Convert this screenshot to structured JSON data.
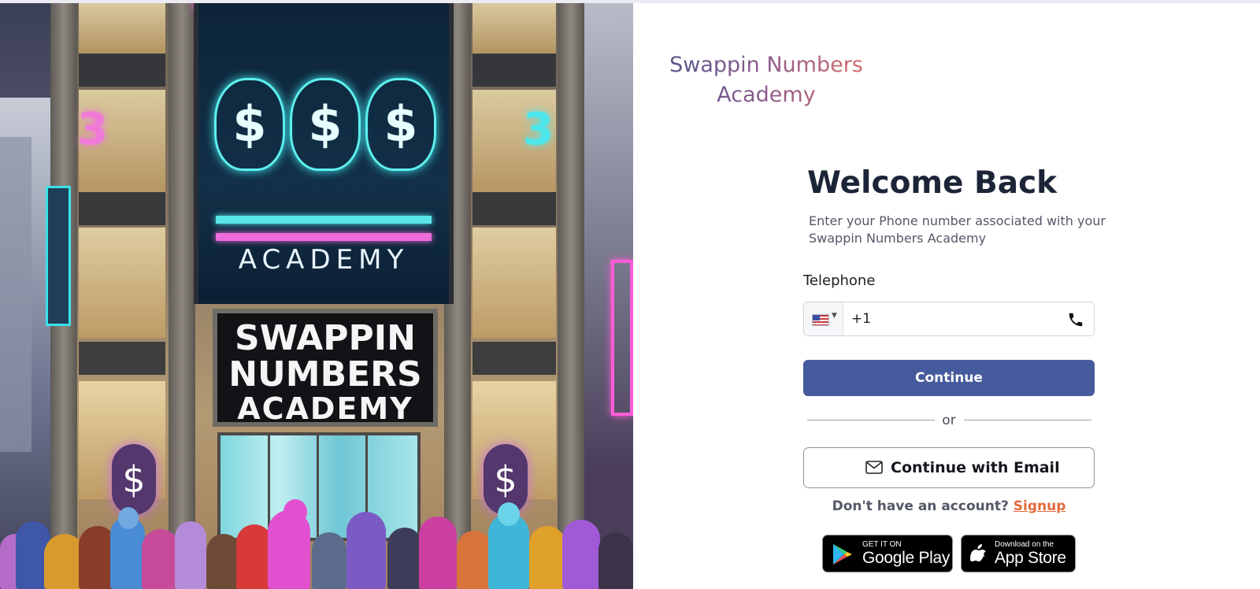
{
  "brand": {
    "line1": "Swappin Numbers",
    "line2": "Academy"
  },
  "hero": {
    "screen_sign": "ACADEMY",
    "marquee": [
      "SWAPPIN",
      "NUMBERS",
      "ACADEMY"
    ],
    "bag_symbol": "$",
    "neon_numbers": [
      "3",
      "3"
    ]
  },
  "login": {
    "title": "Welcome Back",
    "subtitle": "Enter your Phone number associated with your Swappin Numbers Academy",
    "telephone_label": "Telephone",
    "telephone_value": "+1",
    "country_flag": "us-flag-icon",
    "continue_label": "Continue",
    "or_label": "or",
    "email_button_label": "Continue with Email",
    "no_account_text": "Don't have an account?",
    "signup_label": "Signup"
  },
  "stores": {
    "google": {
      "small": "GET IT ON",
      "big": "Google Play"
    },
    "apple": {
      "small": "Download on the",
      "big": "App Store"
    }
  },
  "colors": {
    "primary_button": "#465b9d",
    "signup_link": "#e36b3e",
    "title": "#1c2538",
    "brand_gradient": [
      "#55568b",
      "#d86d6b"
    ]
  }
}
